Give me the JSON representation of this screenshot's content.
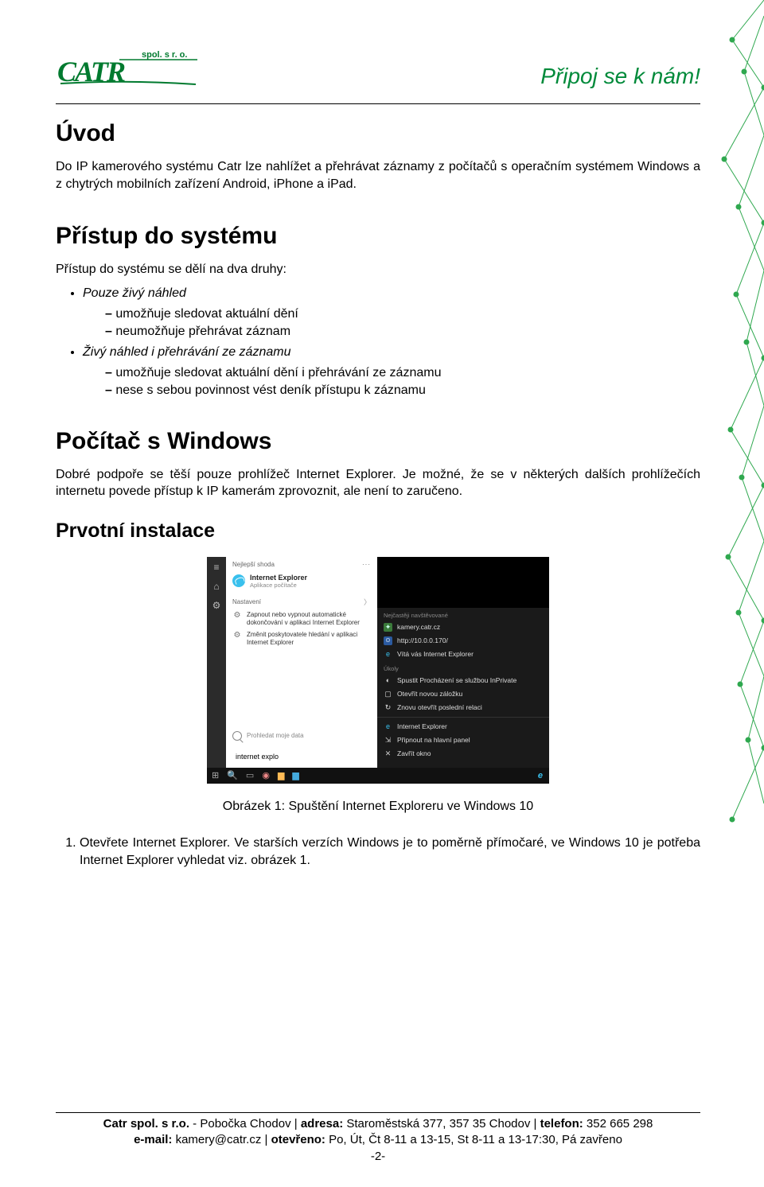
{
  "header": {
    "logo_name": "CATR",
    "logo_sub": "spol. s r. o.",
    "slogan": "Připoj se k nám!"
  },
  "sections": {
    "uvod": {
      "title": "Úvod",
      "p1": "Do IP kamerového systému Catr lze nahlížet a přehrávat záznamy z počítačů s operačním systémem Windows a z chytrých mobilních zařízení Android, iPhone a iPad."
    },
    "pristup": {
      "title": "Přístup do systému",
      "intro": "Přístup do systému se dělí na dva druhy:",
      "b1": "Pouze živý náhled",
      "b1s": [
        "umožňuje sledovat aktuální dění",
        "neumožňuje přehrávat záznam"
      ],
      "b2": "Živý náhled i přehrávání ze záznamu",
      "b2s": [
        "umožňuje sledovat aktuální dění i přehrávání ze záznamu",
        "nese s sebou povinnost vést deník přístupu k záznamu"
      ]
    },
    "windows": {
      "title": "Počítač s Windows",
      "p1": "Dobré podpoře se těší pouze prohlížeč Internet Explorer. Je možné, že se v některých dalších prohlížečích internetu povede přístup k IP kamerám zprovoznit, ale není to zaručeno."
    },
    "instalace": {
      "title": "Prvotní instalace",
      "caption": "Obrázek 1: Spuštění Internet Exploreru ve Windows 10",
      "step1": "Otevřete Internet Explorer. Ve starších verzích Windows je to poměrně přímočaré, ve Windows 10 je potřeba Internet Explorer vyhledat viz. obrázek 1."
    }
  },
  "win_screenshot": {
    "search_header": "Nejlepší shoda",
    "app_name": "Internet Explorer",
    "app_sub": "Aplikace počítače",
    "settings_label": "Nastavení",
    "opt1": "Zapnout nebo vypnout automatické dokončování v aplikaci Internet Explorer",
    "opt2": "Změnit poskytovatele hledání v aplikaci Internet Explorer",
    "search_hint": "Prohledat moje data",
    "typed": "internet explo",
    "dark_visited": "Nejčastěji navštěvované",
    "dr1": "kamery.catr.cz",
    "dr2": "http://10.0.0.170/",
    "dr3": "Vítá vás Internet Explorer",
    "dark_tasks": "Úkoly",
    "dr4": "Spustit Procházení se službou InPrivate",
    "dr5": "Otevřít novou záložku",
    "dr6": "Znovu otevřít poslední relaci",
    "dr7": "Internet Explorer",
    "dr8": "Připnout na hlavní panel",
    "dr9": "Zavřít okno"
  },
  "footer": {
    "l1a": "Catr spol. s r.o.",
    "l1b": " - Pobočka Chodov | ",
    "l1c": "adresa:",
    "l1d": " Staroměstská 377, 357 35 Chodov | ",
    "l1e": "telefon:",
    "l1f": " 352 665 298",
    "l2a": "e-mail:",
    "l2b": " kamery@catr.cz | ",
    "l2c": "otevřeno:",
    "l2d": " Po, Út, Čt 8-11 a 13-15, St 8-11 a 13-17:30, Pá zavřeno",
    "page": "-2-"
  }
}
